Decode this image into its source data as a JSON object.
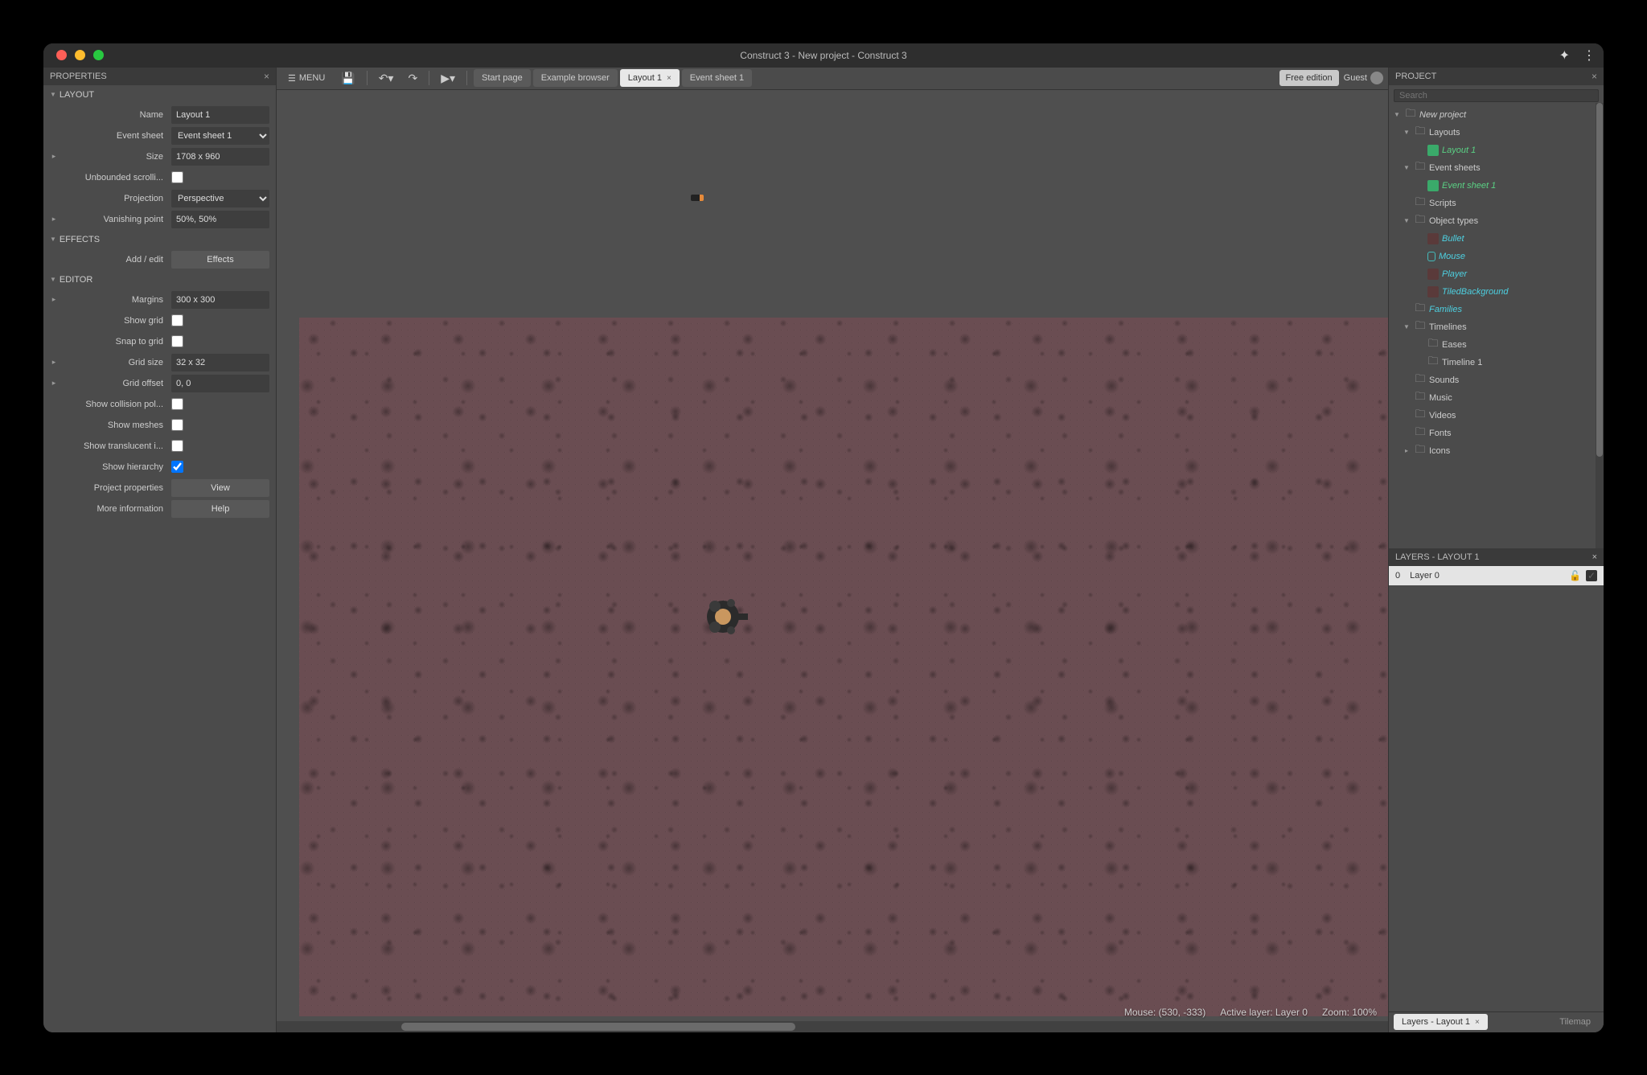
{
  "window": {
    "title": "Construct 3 - New project - Construct 3"
  },
  "toolbar": {
    "menu": "MENU",
    "tabs": {
      "start": "Start page",
      "examples": "Example browser",
      "layout": "Layout 1",
      "eventsheet": "Event sheet 1"
    },
    "free_edition": "Free edition",
    "guest": "Guest"
  },
  "properties": {
    "title": "PROPERTIES",
    "sections": {
      "layout": "LAYOUT",
      "effects": "EFFECTS",
      "editor": "EDITOR"
    },
    "labels": {
      "name": "Name",
      "eventsheet": "Event sheet",
      "size": "Size",
      "unbounded": "Unbounded scrolli...",
      "projection": "Projection",
      "vanishing": "Vanishing point",
      "addedit": "Add / edit",
      "margins": "Margins",
      "showgrid": "Show grid",
      "snapgrid": "Snap to grid",
      "gridsize": "Grid size",
      "gridoffset": "Grid offset",
      "collision": "Show collision pol...",
      "meshes": "Show meshes",
      "translucent": "Show translucent i...",
      "hierarchy": "Show hierarchy",
      "projprops": "Project properties",
      "moreinfo": "More information"
    },
    "values": {
      "name": "Layout 1",
      "eventsheet": "Event sheet 1",
      "size": "1708 x 960",
      "projection": "Perspective",
      "vanishing": "50%, 50%",
      "margins": "300 x 300",
      "gridsize": "32 x 32",
      "gridoffset": "0, 0"
    },
    "buttons": {
      "effects": "Effects",
      "view": "View",
      "help": "Help"
    }
  },
  "canvas": {
    "status": {
      "mouse": "Mouse: (530, -333)",
      "layer": "Active layer: Layer 0",
      "zoom": "Zoom: 100%"
    }
  },
  "project": {
    "title": "PROJECT",
    "search_placeholder": "Search",
    "tree": {
      "root": "New project",
      "layouts": "Layouts",
      "layout1": "Layout 1",
      "eventsheets": "Event sheets",
      "eventsheet1": "Event sheet 1",
      "scripts": "Scripts",
      "objtypes": "Object types",
      "bullet": "Bullet",
      "mouse": "Mouse",
      "player": "Player",
      "tiled": "TiledBackground",
      "families": "Families",
      "timelines": "Timelines",
      "eases": "Eases",
      "timeline1": "Timeline 1",
      "sounds": "Sounds",
      "music": "Music",
      "videos": "Videos",
      "fonts": "Fonts",
      "icons": "Icons"
    }
  },
  "layers": {
    "title": "LAYERS - LAYOUT 1",
    "rows": [
      {
        "index": "0",
        "name": "Layer 0"
      }
    ],
    "tabs": {
      "layers": "Layers - Layout 1",
      "tilemap": "Tilemap"
    }
  }
}
